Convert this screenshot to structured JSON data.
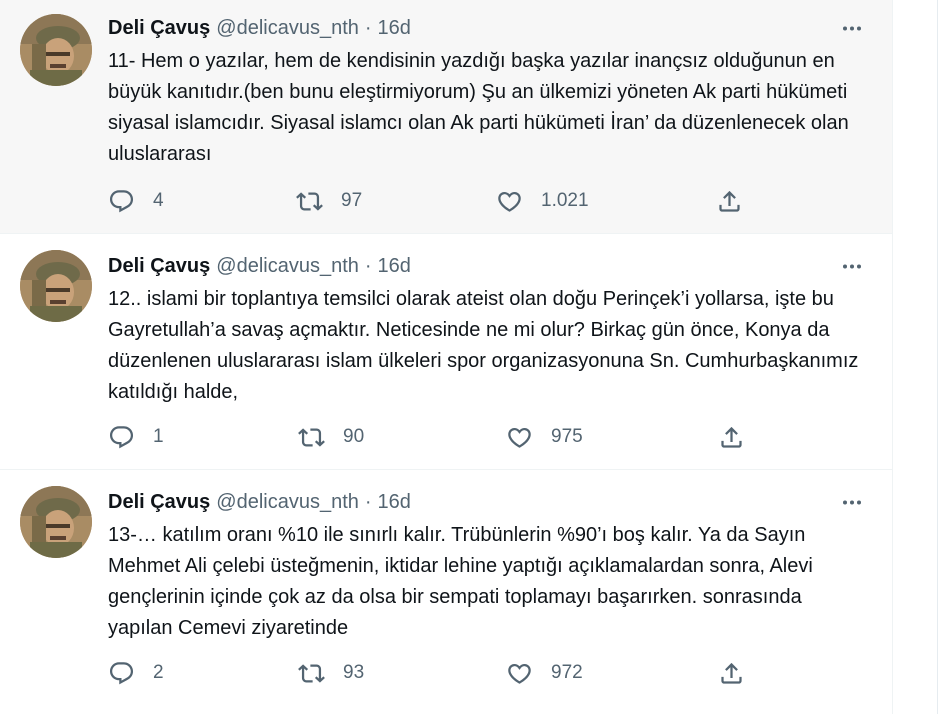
{
  "tweets": [
    {
      "name": "Deli Çavuş",
      "handle": "@delicavus_nth",
      "dot": "·",
      "time": "16d",
      "text": "11- Hem o yazılar, hem de kendisinin yazdığı başka yazılar inançsız olduğunun en büyük kanıtıdır.(ben bunu eleştirmiyorum) Şu an ülkemizi yöneten Ak parti hükümeti siyasal islamcıdır. Siyasal islamcı olan Ak parti hükümeti İran’ da düzenlenecek olan uluslararası",
      "replies": "4",
      "retweets": "97",
      "likes": "1.021"
    },
    {
      "name": "Deli Çavuş",
      "handle": "@delicavus_nth",
      "dot": "·",
      "time": "16d",
      "text": "12.. islami bir toplantıya temsilci olarak ateist olan doğu Perinçek’i yollarsa, işte bu Gayretullah’a savaş açmaktır. Neticesinde ne mi olur? Birkaç gün önce, Konya da düzenlenen uluslararası islam ülkeleri spor organizasyonuna Sn. Cumhurbaşkanımız katıldığı halde,",
      "replies": "1",
      "retweets": "90",
      "likes": "975"
    },
    {
      "name": "Deli Çavuş",
      "handle": "@delicavus_nth",
      "dot": "·",
      "time": "16d",
      "text": "13-… katılım oranı %10 ile sınırlı kalır. Trübünlerin %90’ı boş kalır. Ya da Sayın Mehmet Ali çelebi üsteğmenin, iktidar lehine yaptığı açıklamalardan sonra, Alevi gençlerinin içinde çok az da olsa bir sempati toplamayı başarırken. sonrasında yapılan Cemevi ziyaretinde",
      "replies": "2",
      "retweets": "93",
      "likes": "972"
    }
  ],
  "icons": {
    "more": "more-icon",
    "reply": "reply-icon",
    "retweet": "retweet-icon",
    "like": "heart-icon",
    "share": "share-icon"
  },
  "colors": {
    "text": "#0f1419",
    "secondary": "#536471",
    "hover_bg": "#f7f7f7",
    "divider": "#eff3f4"
  }
}
